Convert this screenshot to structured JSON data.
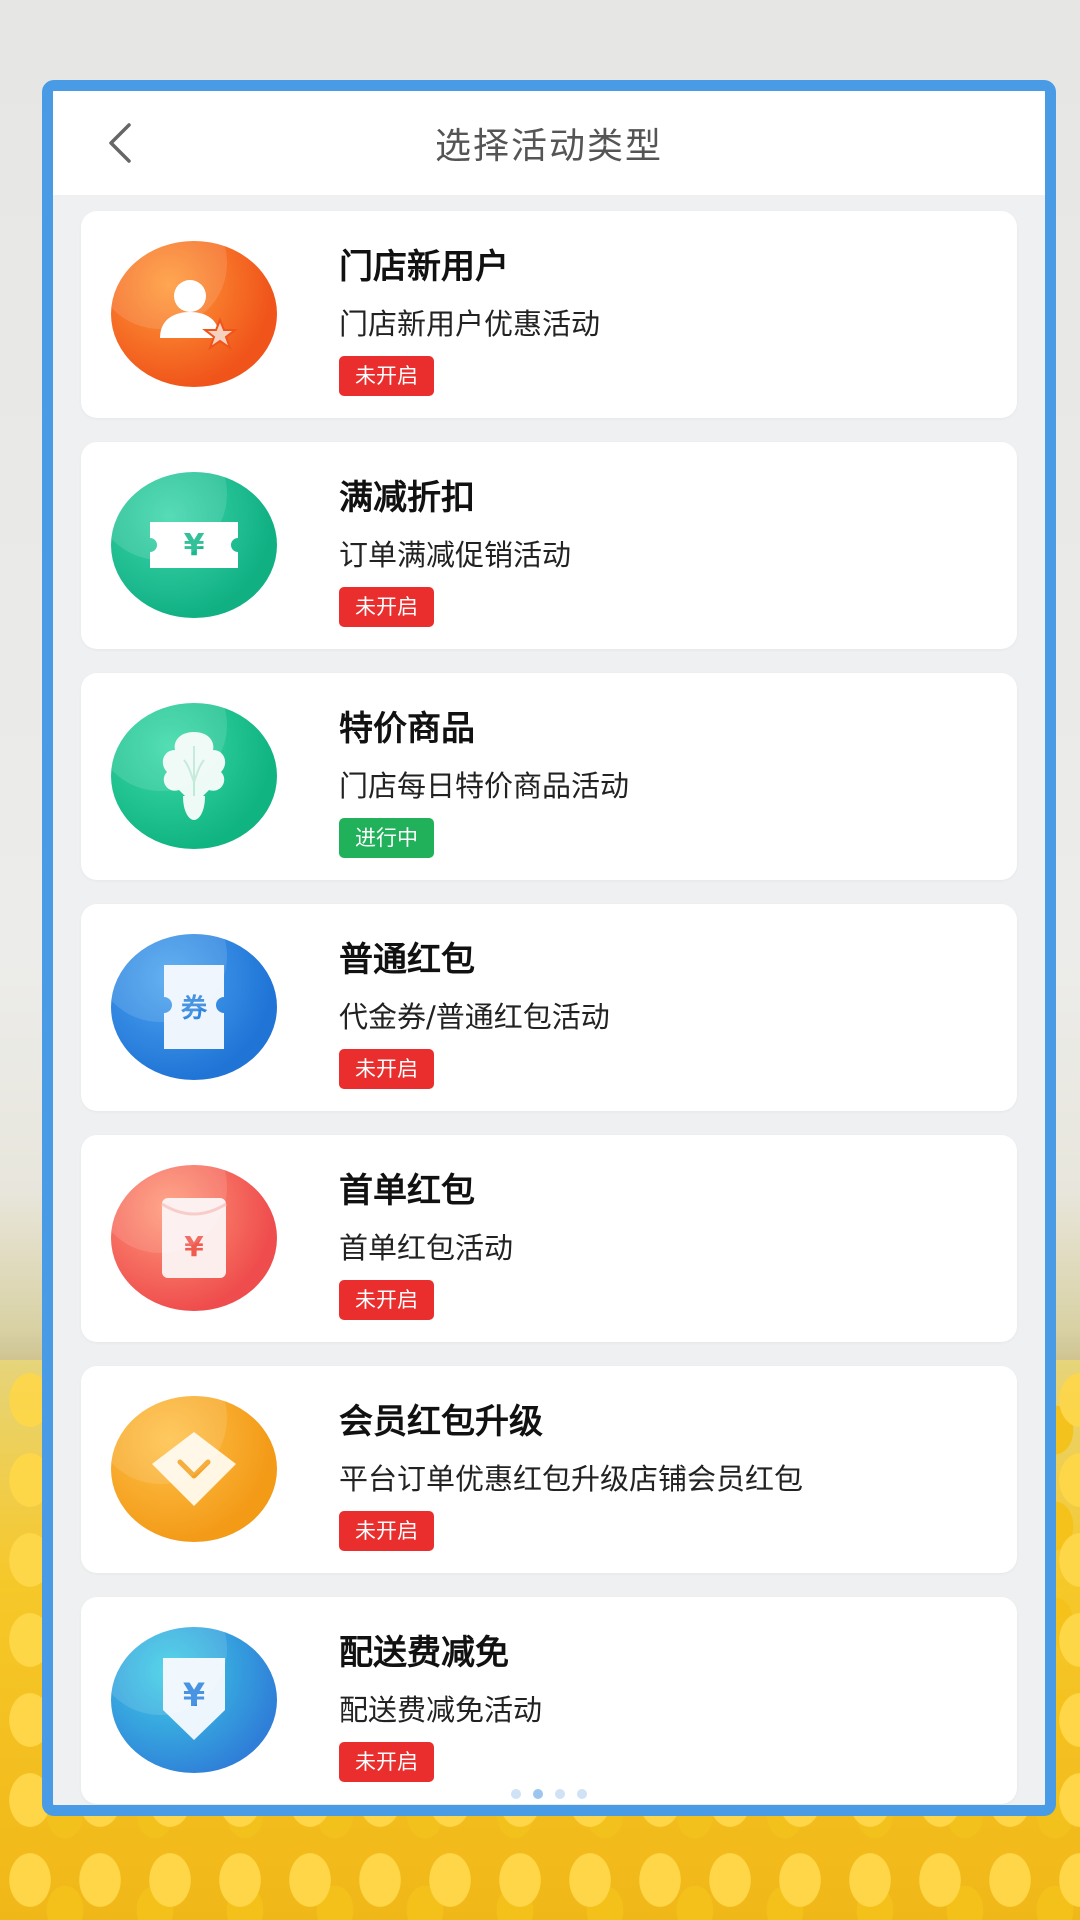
{
  "header": {
    "title": "选择活动类型",
    "back_icon": "chevron-left-icon"
  },
  "activities": [
    {
      "title": "门店新用户",
      "desc": "门店新用户优惠活动",
      "status": "未开启",
      "active": false,
      "icon": "user-star-icon",
      "color": "#f2611c"
    },
    {
      "title": "满减折扣",
      "desc": "订单满减促销活动",
      "status": "未开启",
      "active": false,
      "icon": "yuan-ticket-icon",
      "color": "#1fbf95"
    },
    {
      "title": "特价商品",
      "desc": "门店每日特价商品活动",
      "status": "进行中",
      "active": true,
      "icon": "cabbage-icon",
      "color": "#18bf92"
    },
    {
      "title": "普通红包",
      "desc": "代金券/普通红包活动",
      "status": "未开启",
      "active": false,
      "icon": "voucher-icon",
      "color": "#2f86df"
    },
    {
      "title": "首单红包",
      "desc": "首单红包活动",
      "status": "未开启",
      "active": false,
      "icon": "red-envelope-icon",
      "color": "#f26b5a"
    },
    {
      "title": "会员红包升级",
      "desc": "平台订单优惠红包升级店铺会员红包",
      "status": "未开启",
      "active": false,
      "icon": "diamond-icon",
      "color": "#f6a524"
    },
    {
      "title": "配送费减免",
      "desc": "配送费减免活动",
      "status": "未开启",
      "active": false,
      "icon": "yuan-down-icon",
      "color": "#3aa6e6"
    }
  ],
  "pager": {
    "count": 4,
    "active_index": 1
  }
}
